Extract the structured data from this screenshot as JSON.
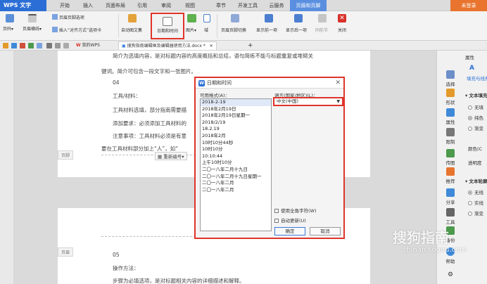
{
  "app": {
    "badge": "WPS 文字",
    "login": "未登录"
  },
  "menu": [
    "开始",
    "插入",
    "页面布局",
    "引用",
    "审阅",
    "视图",
    "章节",
    "开发工具",
    "云服务",
    "页眉和页脚"
  ],
  "ribbon": {
    "page_num": "页码",
    "header_line": "页眉横线",
    "header_option": "页眉页脚选项",
    "insert_align": "插入“对齐方式”选项卡",
    "gallery": "自动图文集",
    "datetime": "日期和时间",
    "picture": "图片",
    "field": "域",
    "switch": "页眉页脚切换",
    "show_prev": "显示前一项",
    "show_next": "显示后一项",
    "same_prev": "同前节",
    "close": "关闭"
  },
  "tabs": {
    "doc1": "我的WPS",
    "doc2": "搜狗指南编辑框及编辑器使用方法.docx *"
  },
  "doc": {
    "l1": "简介为选填内容，是对标题内容的高度概括和总结，语句简练不能与标题重复或堆砌关",
    "l2": "键词。简介可包含一段文字和一张图片。",
    "l3": "04",
    "l4": "工具/材料：",
    "l5": "工具材料选填，部分指南需要描",
    "l6": "添加要求：必须添加工具材料的",
    "l7": "注意事项：工具材料必须是有意",
    "l8": "要在工具材料部分加上“人”，如“",
    "footer": "页脚",
    "renumber": "重新编号",
    "header2": "页眉",
    "l9": "05",
    "l10": "操作方法：",
    "l11": "步骤为必填选项，是对标题相关内容的详细描述和解释。"
  },
  "dialog": {
    "title": "日期和时间",
    "formats_label": "可用格式(A)：",
    "formats": [
      "2018-2-19",
      "2018年2月19日",
      "2018年2月19日星期一",
      "2018/2/19",
      "18.2.19",
      "2018年2月",
      "10时10分44秒",
      "10时10分",
      "10:10:44",
      "上午10时10分",
      "二〇一八年二月十九日",
      "二〇一八年二月十九日星期一",
      "二〇一八年二月",
      "二〇一八年二月"
    ],
    "lang_label": "语言(国家/地区)(L)：",
    "lang_value": "中文(中国)",
    "fullwidth": "使用全角字符(W)",
    "autoupdate": "自动更新(U)",
    "ok": "确定",
    "cancel": "取消"
  },
  "right_panel": {
    "select": "选择",
    "shape": "形状",
    "properties": "属性",
    "limit": "限制",
    "transfer": "传图",
    "recommend": "推荐",
    "share": "分享",
    "tools": "工具",
    "backup": "备份",
    "help": "帮助",
    "prop_title": "属性",
    "prop_tab": "填充与线条",
    "fill_section": "文本填充",
    "opt_none": "无填",
    "opt_solid": "纯色",
    "opt_gradient": "渐变",
    "color_label": "颜色(C",
    "transparency": "透明度",
    "outline_section": "文本轮廓",
    "opt_none2": "无线",
    "opt_solid2": "实线",
    "opt_gradient2": "渐变"
  },
  "watermark": {
    "brand": "搜狗指南",
    "url": "zhinan.sogou.com"
  },
  "colors": {
    "accent": "#2b6fd6",
    "highlight": "#e0342a",
    "orange": "#e8742e"
  }
}
